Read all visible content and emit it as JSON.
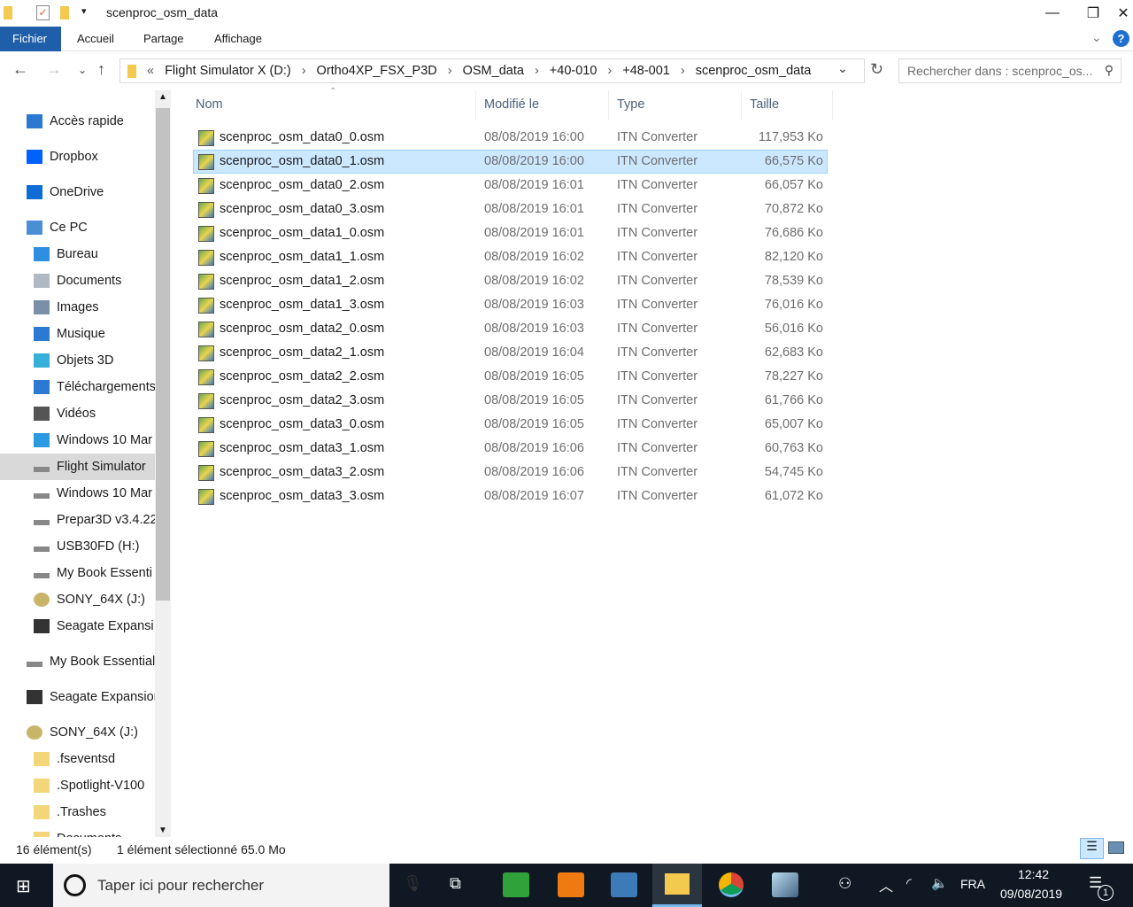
{
  "window": {
    "title": "scenproc_osm_data",
    "minimize": "—",
    "maximize": "❐",
    "close": "✕"
  },
  "ribbon": {
    "tabs": [
      "Fichier",
      "Accueil",
      "Partage",
      "Affichage"
    ],
    "help": "?"
  },
  "address": {
    "crumbs": [
      "Flight Simulator X (D:)",
      "Ortho4XP_FSX_P3D",
      "OSM_data",
      "+40-010",
      "+48-001",
      "scenproc_osm_data"
    ],
    "overflow": "«"
  },
  "search": {
    "placeholder": "Rechercher dans : scenproc_os..."
  },
  "sidebar": {
    "items": [
      {
        "label": "Accès rapide",
        "level": 0,
        "icon": "star-icon",
        "color": "#2b79d0"
      },
      {
        "label": "Dropbox",
        "level": 0,
        "icon": "dropbox-icon",
        "color": "#0061fe"
      },
      {
        "label": "OneDrive",
        "level": 0,
        "icon": "cloud-icon",
        "color": "#0f6cd6"
      },
      {
        "label": "Ce PC",
        "level": 0,
        "icon": "computer-icon",
        "color": "#4a8fd6"
      },
      {
        "label": "Bureau",
        "level": 1,
        "icon": "desktop-icon",
        "color": "#2c8fe0"
      },
      {
        "label": "Documents",
        "level": 1,
        "icon": "document-icon",
        "color": "#b0b8c4"
      },
      {
        "label": "Images",
        "level": 1,
        "icon": "picture-icon",
        "color": "#7a8fa8"
      },
      {
        "label": "Musique",
        "level": 1,
        "icon": "music-icon",
        "color": "#2b79d0"
      },
      {
        "label": "Objets 3D",
        "level": 1,
        "icon": "cube-icon",
        "color": "#36b0d8"
      },
      {
        "label": "Téléchargements",
        "level": 1,
        "icon": "download-icon",
        "color": "#2b79d0"
      },
      {
        "label": "Vidéos",
        "level": 1,
        "icon": "film-icon",
        "color": "#555"
      },
      {
        "label": "Windows 10 Mar",
        "level": 1,
        "icon": "windows-drive-icon",
        "color": "#2b9ae0"
      },
      {
        "label": "Flight Simulator",
        "level": 1,
        "icon": "drive-icon",
        "color": "#888",
        "selected": true
      },
      {
        "label": "Windows 10 Mar",
        "level": 1,
        "icon": "drive-icon",
        "color": "#888"
      },
      {
        "label": "Prepar3D v3.4.22",
        "level": 1,
        "icon": "drive-icon",
        "color": "#888"
      },
      {
        "label": "USB30FD (H:)",
        "level": 1,
        "icon": "drive-icon",
        "color": "#888"
      },
      {
        "label": "My Book Essenti",
        "level": 1,
        "icon": "drive-icon",
        "color": "#888"
      },
      {
        "label": "SONY_64X (J:)",
        "level": 1,
        "icon": "disc-icon",
        "color": "#c9b56a"
      },
      {
        "label": "Seagate Expansi",
        "level": 1,
        "icon": "external-drive-icon",
        "color": "#333"
      },
      {
        "label": "My Book Essential",
        "level": 0,
        "icon": "drive-icon",
        "color": "#888"
      },
      {
        "label": "Seagate Expansion",
        "level": 0,
        "icon": "external-drive-icon",
        "color": "#333"
      },
      {
        "label": "SONY_64X (J:)",
        "level": 0,
        "icon": "disc-icon",
        "color": "#c9b56a"
      },
      {
        "label": ".fseventsd",
        "level": 1,
        "icon": "folder-icon",
        "color": "#f3d57a"
      },
      {
        "label": ".Spotlight-V100",
        "level": 1,
        "icon": "folder-icon",
        "color": "#f3d57a"
      },
      {
        "label": ".Trashes",
        "level": 1,
        "icon": "folder-icon",
        "color": "#f3d57a"
      },
      {
        "label": "Documents",
        "level": 1,
        "icon": "folder-icon",
        "color": "#f3d57a"
      }
    ]
  },
  "columns": {
    "name": "Nom",
    "modified": "Modifié le",
    "type": "Type",
    "size": "Taille"
  },
  "files": [
    [
      "scenproc_osm_data0_0.osm",
      "08/08/2019 16:00",
      "ITN Converter",
      "117,953 Ko"
    ],
    [
      "scenproc_osm_data0_1.osm",
      "08/08/2019 16:00",
      "ITN Converter",
      "66,575 Ko"
    ],
    [
      "scenproc_osm_data0_2.osm",
      "08/08/2019 16:01",
      "ITN Converter",
      "66,057 Ko"
    ],
    [
      "scenproc_osm_data0_3.osm",
      "08/08/2019 16:01",
      "ITN Converter",
      "70,872 Ko"
    ],
    [
      "scenproc_osm_data1_0.osm",
      "08/08/2019 16:01",
      "ITN Converter",
      "76,686 Ko"
    ],
    [
      "scenproc_osm_data1_1.osm",
      "08/08/2019 16:02",
      "ITN Converter",
      "82,120 Ko"
    ],
    [
      "scenproc_osm_data1_2.osm",
      "08/08/2019 16:02",
      "ITN Converter",
      "78,539 Ko"
    ],
    [
      "scenproc_osm_data1_3.osm",
      "08/08/2019 16:03",
      "ITN Converter",
      "76,016 Ko"
    ],
    [
      "scenproc_osm_data2_0.osm",
      "08/08/2019 16:03",
      "ITN Converter",
      "56,016 Ko"
    ],
    [
      "scenproc_osm_data2_1.osm",
      "08/08/2019 16:04",
      "ITN Converter",
      "62,683 Ko"
    ],
    [
      "scenproc_osm_data2_2.osm",
      "08/08/2019 16:05",
      "ITN Converter",
      "78,227 Ko"
    ],
    [
      "scenproc_osm_data2_3.osm",
      "08/08/2019 16:05",
      "ITN Converter",
      "61,766 Ko"
    ],
    [
      "scenproc_osm_data3_0.osm",
      "08/08/2019 16:05",
      "ITN Converter",
      "65,007 Ko"
    ],
    [
      "scenproc_osm_data3_1.osm",
      "08/08/2019 16:06",
      "ITN Converter",
      "60,763 Ko"
    ],
    [
      "scenproc_osm_data3_2.osm",
      "08/08/2019 16:06",
      "ITN Converter",
      "54,745 Ko"
    ],
    [
      "scenproc_osm_data3_3.osm",
      "08/08/2019 16:07",
      "ITN Converter",
      "61,072 Ko"
    ]
  ],
  "selected_index": 1,
  "status": {
    "count": "16 élément(s)",
    "selection": "1 élément sélectionné  65.0 Mo"
  },
  "taskbar": {
    "search_placeholder": "Taper ici pour rechercher",
    "language": "FRA",
    "time": "12:42",
    "date": "09/08/2019",
    "notifications": "1"
  }
}
